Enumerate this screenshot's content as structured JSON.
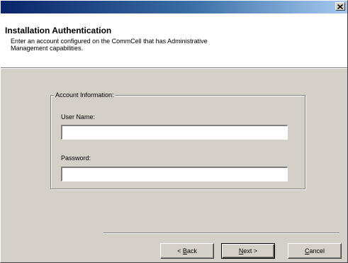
{
  "window": {
    "title": "",
    "close_icon": "close-icon"
  },
  "header": {
    "title": "Installation Authentication",
    "description": "Enter an account configured on the CommCell that has Administrative Management capabilities."
  },
  "account_group": {
    "label": "Account Information:",
    "username": {
      "label": "User Name:",
      "value": ""
    },
    "password": {
      "label": "Password:",
      "value": ""
    }
  },
  "buttons": {
    "back": {
      "label": "< Back",
      "mnemonic": "B"
    },
    "next": {
      "label": "Next >",
      "mnemonic": "N"
    },
    "cancel": {
      "label": "Cancel",
      "mnemonic": "C"
    }
  },
  "colors": {
    "dialog_face": "#d4d0c8",
    "title_gradient_start": "#0a246a",
    "title_gradient_end": "#a6caf0"
  }
}
